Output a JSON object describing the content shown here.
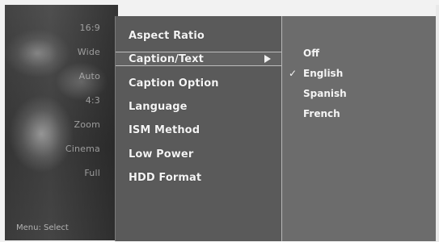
{
  "background": {
    "ghost_labels": [
      "16:9",
      "Wide",
      "Auto",
      "4:3",
      "Zoom",
      "Cinema",
      "Full"
    ],
    "bottom_hint": "Menu: Select"
  },
  "menu": {
    "items": [
      {
        "label": "Aspect Ratio"
      },
      {
        "label": "Caption/Text",
        "highlighted": true,
        "has_submenu": true
      },
      {
        "label": "Caption Option"
      },
      {
        "label": "Language"
      },
      {
        "label": "ISM Method"
      },
      {
        "label": "Low Power"
      },
      {
        "label": "HDD Format"
      }
    ],
    "submenu_arrow_icon": "triangle-right-icon"
  },
  "submenu": {
    "items": [
      {
        "label": "Off",
        "checked": false
      },
      {
        "label": "English",
        "checked": true
      },
      {
        "label": "Spanish",
        "checked": false
      },
      {
        "label": "French",
        "checked": false
      }
    ],
    "check_glyph": "✓"
  },
  "colors": {
    "menu_bg": "#5a5a5a",
    "submenu_bg": "#6c6c6c",
    "text": "#f4f4f4"
  }
}
